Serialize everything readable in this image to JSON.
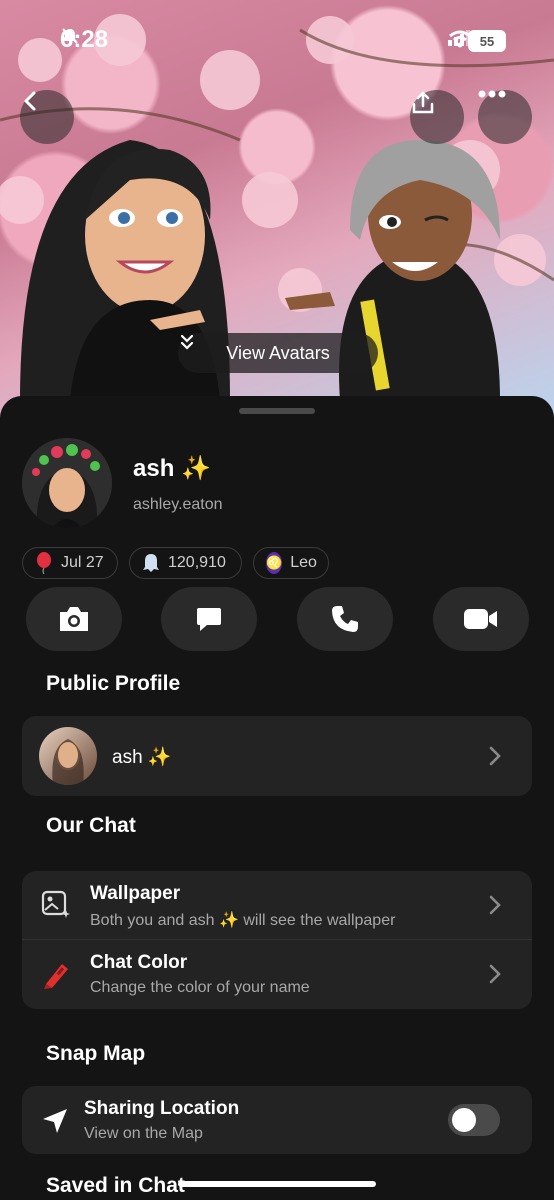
{
  "status_bar": {
    "time": "6:28",
    "battery": "55"
  },
  "hero": {
    "view_avatars_label": "View Avatars"
  },
  "profile": {
    "name": "ash ✨",
    "username": "ashley.eaton"
  },
  "pills": {
    "birthday": "Jul 27",
    "score": "120,910",
    "zodiac": "Leo"
  },
  "sections": {
    "public_profile": "Public Profile",
    "our_chat": "Our Chat",
    "snap_map": "Snap Map",
    "saved_in_chat": "Saved in Chat"
  },
  "public_profile_card": {
    "name": "ash ✨"
  },
  "our_chat_rows": [
    {
      "title": "Wallpaper",
      "subtitle": "Both you and ash ✨ will see the wallpaper"
    },
    {
      "title": "Chat Color",
      "subtitle": "Change the color of your name"
    }
  ],
  "snap_map_row": {
    "title": "Sharing Location",
    "subtitle": "View on the Map",
    "toggle_on": false
  },
  "colors": {
    "background": "#141414",
    "card": "#232323",
    "accent_purple": "#5a2fb0"
  }
}
